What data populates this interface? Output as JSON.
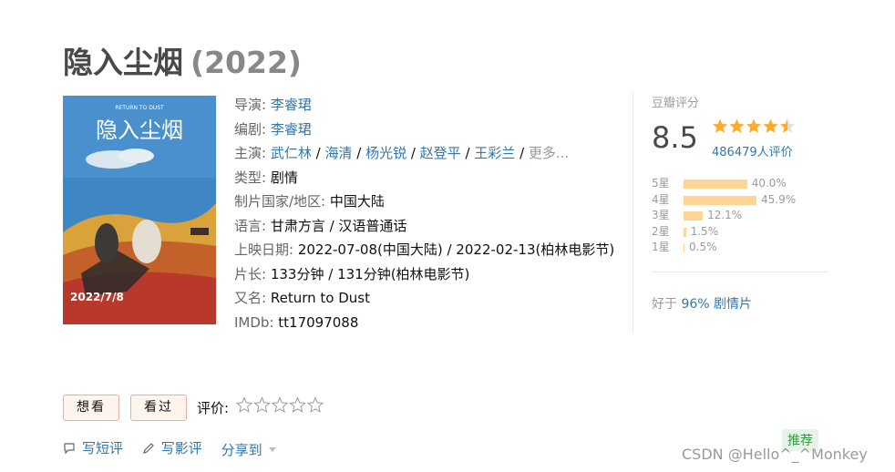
{
  "movie": {
    "title": "隐入尘烟",
    "year": "(2022)"
  },
  "poster": {
    "en_title": "RETURN TO DUST",
    "cn_title": "隐入尘烟",
    "date": "2022/7/8"
  },
  "info": {
    "director_label": "导演:",
    "director": "李睿珺",
    "writer_label": "编剧:",
    "writer": "李睿珺",
    "cast_label": "主演:",
    "cast": [
      "武仁林",
      "海清",
      "杨光锐",
      "赵登平",
      "王彩兰"
    ],
    "cast_sep": " / ",
    "cast_more": "更多...",
    "genre_label": "类型:",
    "genre": "剧情",
    "country_label": "制片国家/地区:",
    "country": "中国大陆",
    "language_label": "语言:",
    "language": "甘肃方言 / 汉语普通话",
    "release_label": "上映日期:",
    "release": "2022-07-08(中国大陆) / 2022-02-13(柏林电影节)",
    "runtime_label": "片长:",
    "runtime": "133分钟 / 131分钟(柏林电影节)",
    "aka_label": "又名:",
    "aka": "Return to Dust",
    "imdb_label": "IMDb:",
    "imdb": "tt17097088"
  },
  "rating": {
    "label": "豆瓣评分",
    "score": "8.5",
    "stars_value": 4.5,
    "votes": "486479人评价",
    "distribution": [
      {
        "label": "5星",
        "percent": 40.0,
        "text": "40.0%"
      },
      {
        "label": "4星",
        "percent": 45.9,
        "text": "45.9%"
      },
      {
        "label": "3星",
        "percent": 12.1,
        "text": "12.1%"
      },
      {
        "label": "2星",
        "percent": 1.5,
        "text": "1.5%"
      },
      {
        "label": "1星",
        "percent": 0.5,
        "text": "0.5%"
      }
    ],
    "better_prefix": "好于",
    "better_link": "96% 剧情片"
  },
  "actions": {
    "want_label": "想看",
    "watched_label": "看过",
    "rate_label": "评价:",
    "short_review": "写短评",
    "long_review": "写影评",
    "share": "分享到"
  },
  "tag": "推荐",
  "watermark": "CSDN @Hello^_^Monkey",
  "colors": {
    "link": "#3377aa",
    "star": "#ffac2d",
    "bar": "#ffd596"
  }
}
